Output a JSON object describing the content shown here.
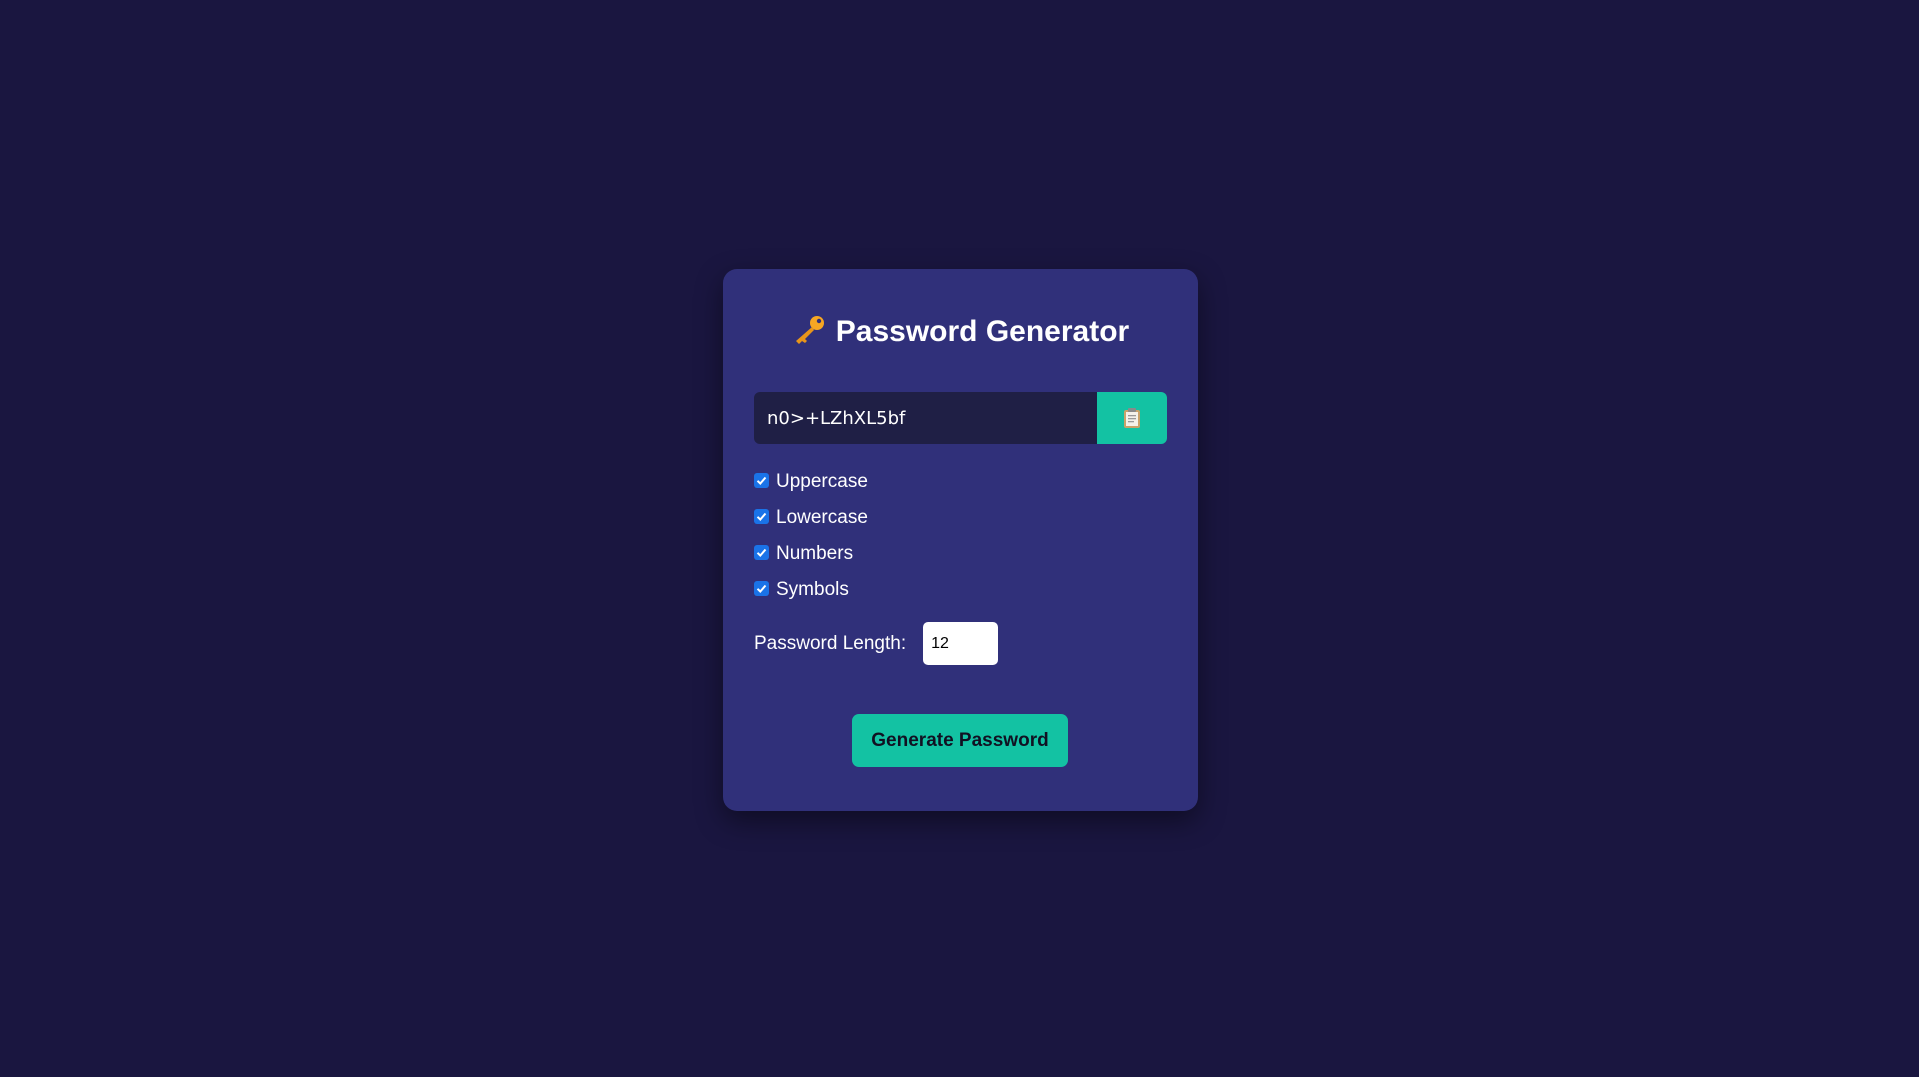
{
  "app": {
    "title": "Password Generator",
    "title_icon": "key-icon"
  },
  "password": {
    "value": "n0>+LZhXL5bf",
    "copy_icon": "clipboard-icon"
  },
  "options": [
    {
      "label": "Uppercase",
      "checked": true
    },
    {
      "label": "Lowercase",
      "checked": true
    },
    {
      "label": "Numbers",
      "checked": true
    },
    {
      "label": "Symbols",
      "checked": true
    }
  ],
  "length": {
    "label": "Password Length:",
    "value": "12"
  },
  "generate": {
    "label": "Generate Password"
  },
  "colors": {
    "background": "#1a1640",
    "card": "#30307a",
    "accent": "#13c2a3",
    "field": "#1f1f45",
    "checkbox": "#1a73e8"
  }
}
